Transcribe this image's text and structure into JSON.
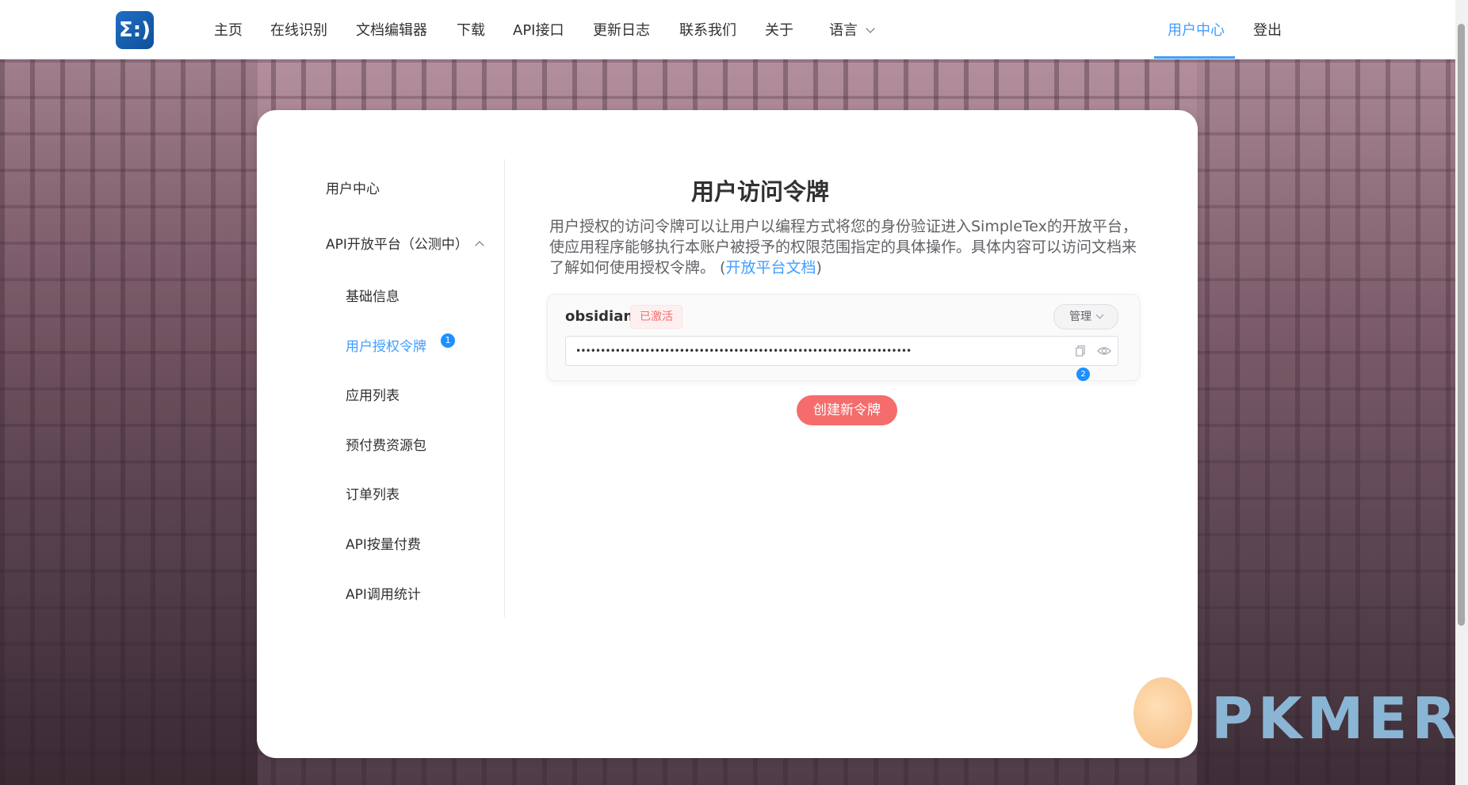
{
  "nav": {
    "logo_symbol": "Σ:)",
    "items": [
      "主页",
      "在线识别",
      "文档编辑器",
      "下载",
      "API接口",
      "更新日志",
      "联系我们",
      "关于",
      "语言"
    ],
    "user_center": "用户中心",
    "logout": "登出"
  },
  "sidebar": {
    "user_center": "用户中心",
    "api_platform": "API开放平台（公测中）",
    "items": [
      "基础信息",
      "用户授权令牌",
      "应用列表",
      "预付费资源包",
      "订单列表",
      "API按量付费",
      "API调用统计"
    ],
    "badge_1": "1"
  },
  "main": {
    "title": "用户访问令牌",
    "description": "用户授权的访问令牌可以让用户以编程方式将您的身份验证进入SimpleTex的开放平台，使应用程序能够执行本账户被授予的权限范围指定的具体操作。具体内容可以访问文档来了解如何使用授权令牌。 (",
    "doc_link": "开放平台文档",
    "description_end": ")",
    "token": {
      "name": "obsidian",
      "status": "已激活",
      "manage_label": "管理",
      "masked_value": "••••••••••••••••••••••••••••••••••••••••••••••••••••••••••••••••••••",
      "badge_2": "2"
    },
    "create_button": "创建新令牌"
  },
  "watermark": "PKMER",
  "colors": {
    "accent": "#409eff",
    "danger": "#f56c6c"
  }
}
